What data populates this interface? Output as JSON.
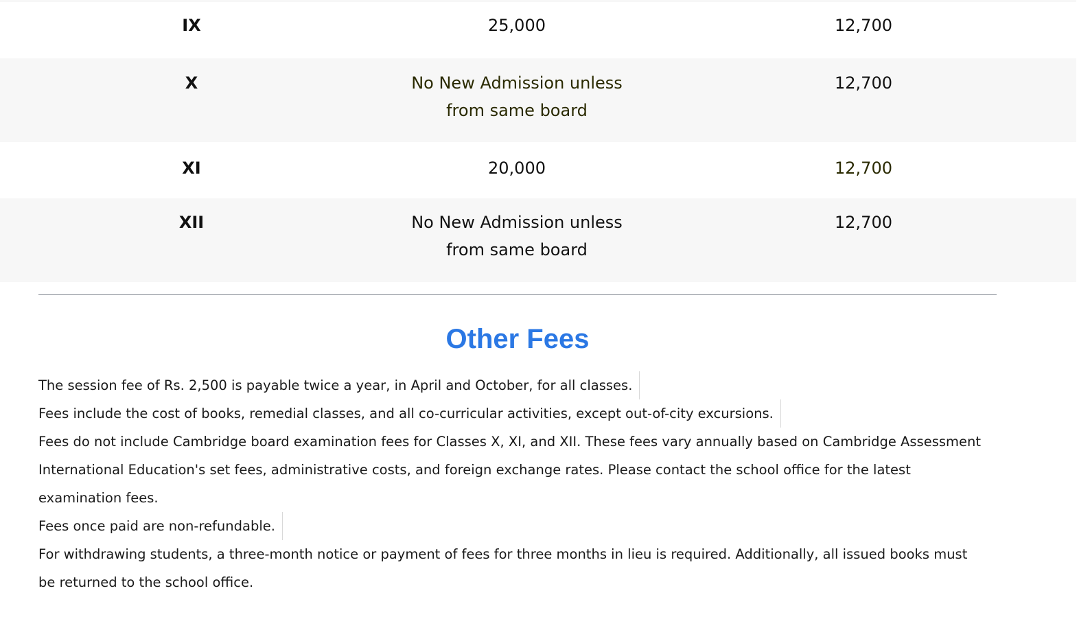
{
  "fee_table": {
    "rows": [
      {
        "class": "IX",
        "admission": "25,000",
        "monthly": "12,700"
      },
      {
        "class": "X",
        "admission": "No New Admission unless from same board",
        "monthly": "12,700"
      },
      {
        "class": "XI",
        "admission": "20,000",
        "monthly": "12,700"
      },
      {
        "class": "XII",
        "admission": "No New Admission unless from same board",
        "monthly": "12,700"
      }
    ]
  },
  "other_fees": {
    "title": "Other Fees",
    "notes": [
      "The session fee of Rs. 2,500 is payable twice a year, in April and October, for all classes.",
      "Fees include the cost of books, remedial classes, and all co-curricular activities, except out-of-city excursions.",
      "Fees do not include Cambridge board examination fees for Classes X, XI, and XII. These fees vary annually based on Cambridge Assessment International Education's set fees, administrative costs, and foreign exchange rates. Please contact the school office for the latest examination fees.",
      "Fees once paid are non-refundable.",
      "For withdrawing students, a three-month notice or payment of fees for three months in lieu is required. Additionally, all issued books must be returned to the school office."
    ]
  },
  "colors": {
    "title_blue": "#2b78e4",
    "row_shade": "#f7f7f7",
    "divider": "#8a8f98"
  }
}
